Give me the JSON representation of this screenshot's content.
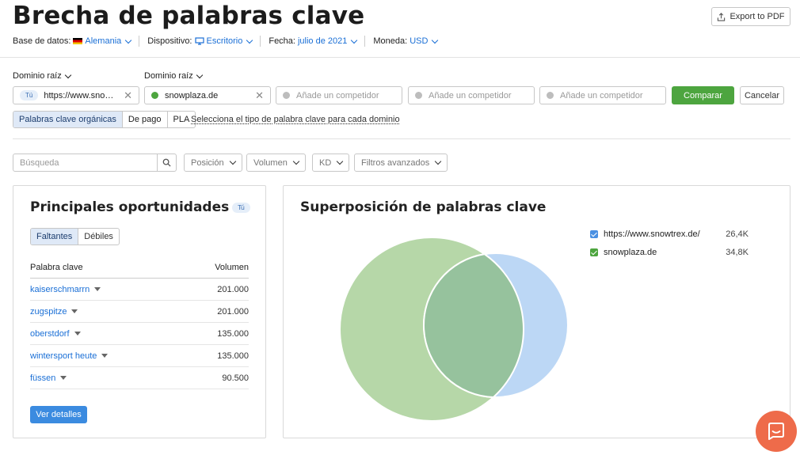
{
  "header": {
    "title": "Brecha de palabras clave",
    "export_label": "Export to PDF"
  },
  "meta": {
    "database_label": "Base de datos:",
    "database_value": "Alemania",
    "device_label": "Dispositivo:",
    "device_value": "Escritorio",
    "date_label": "Fecha:",
    "date_value": "julio de 2021",
    "currency_label": "Moneda:",
    "currency_value": "USD"
  },
  "domains": {
    "root_label": "Dominio raíz",
    "tu_badge": "Tú",
    "domain1": "https://www.sno…",
    "domain2": "snowplaza.de",
    "competitor_placeholder": "Añade un competidor",
    "compare_label": "Comparar",
    "cancel_label": "Cancelar",
    "colors": {
      "domain2_dot": "#4da53f",
      "competitor_dot": "#bdbdbd"
    }
  },
  "keyword_types": {
    "options": [
      "Palabras clave orgánicas",
      "De pago",
      "PLA"
    ],
    "selected": "Palabras clave orgánicas",
    "hint": "Selecciona el tipo de palabra clave para cada dominio"
  },
  "filters": {
    "search_placeholder": "Búsqueda",
    "position": "Posición",
    "volume": "Volumen",
    "kd": "KD",
    "advanced": "Filtros avanzados"
  },
  "opportunities": {
    "title": "Principales oportunidades",
    "tu_badge": "Tú",
    "tabs": [
      "Faltantes",
      "Débiles"
    ],
    "selected_tab": "Faltantes",
    "col_keyword": "Palabra clave",
    "col_volume": "Volumen",
    "rows": [
      {
        "keyword": "kaiserschmarrn",
        "volume": "201.000"
      },
      {
        "keyword": "zugspitze",
        "volume": "201.000"
      },
      {
        "keyword": "oberstdorf",
        "volume": "135.000"
      },
      {
        "keyword": "wintersport heute",
        "volume": "135.000"
      },
      {
        "keyword": "füssen",
        "volume": "90.500"
      }
    ],
    "details_label": "Ver detalles"
  },
  "overlap": {
    "title": "Superposición de palabras clave",
    "legend": [
      {
        "name": "https://www.snowtrex.de/",
        "value": "26,4K",
        "color": "#4a90e2"
      },
      {
        "name": "snowplaza.de",
        "value": "34,8K",
        "color": "#4da53f"
      }
    ],
    "colors": {
      "circle_a": "#b6d7a8",
      "circle_b": "#bcd7f5",
      "intersection": "#96c29d"
    }
  },
  "chat": {
    "icon": "chat-icon"
  }
}
